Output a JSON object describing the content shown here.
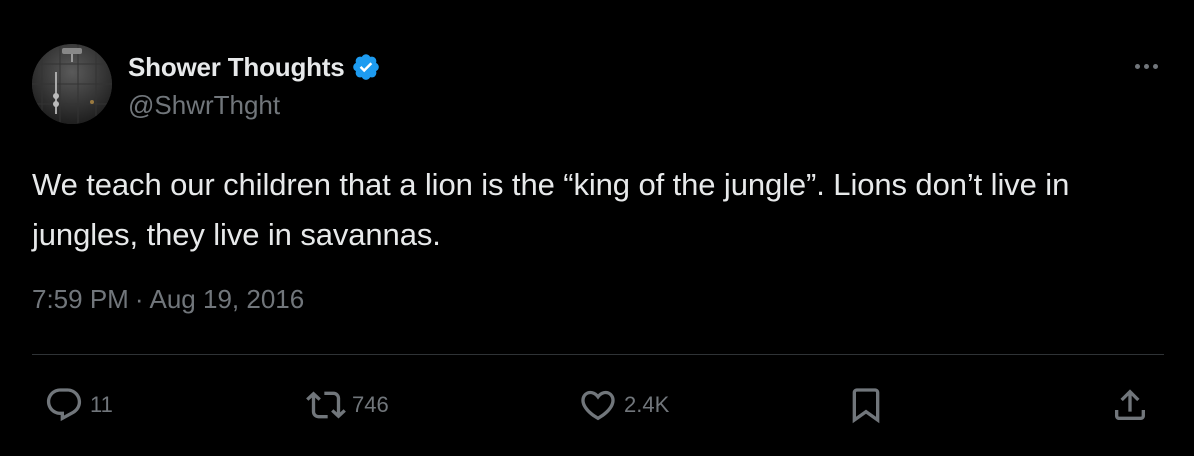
{
  "author": {
    "display_name": "Shower Thoughts",
    "handle": "@ShwrThght",
    "verified_color": "#1d9bf0"
  },
  "tweet": {
    "text": "We teach our children that a lion is the “king of the jungle”. Lions don’t live in jungles, they live in savannas.",
    "time": "7:59 PM",
    "separator": "·",
    "date": "Aug 19, 2016"
  },
  "actions": {
    "replies": "11",
    "retweets": "746",
    "likes": "2.4K"
  },
  "icons": [
    "more-icon",
    "reply-icon",
    "retweet-icon",
    "like-icon",
    "bookmark-icon",
    "share-icon",
    "verified-badge-icon"
  ],
  "colors": {
    "background": "#000000",
    "primary_text": "#e7e9ea",
    "secondary_text": "#71767b",
    "divider": "#2f3336"
  }
}
